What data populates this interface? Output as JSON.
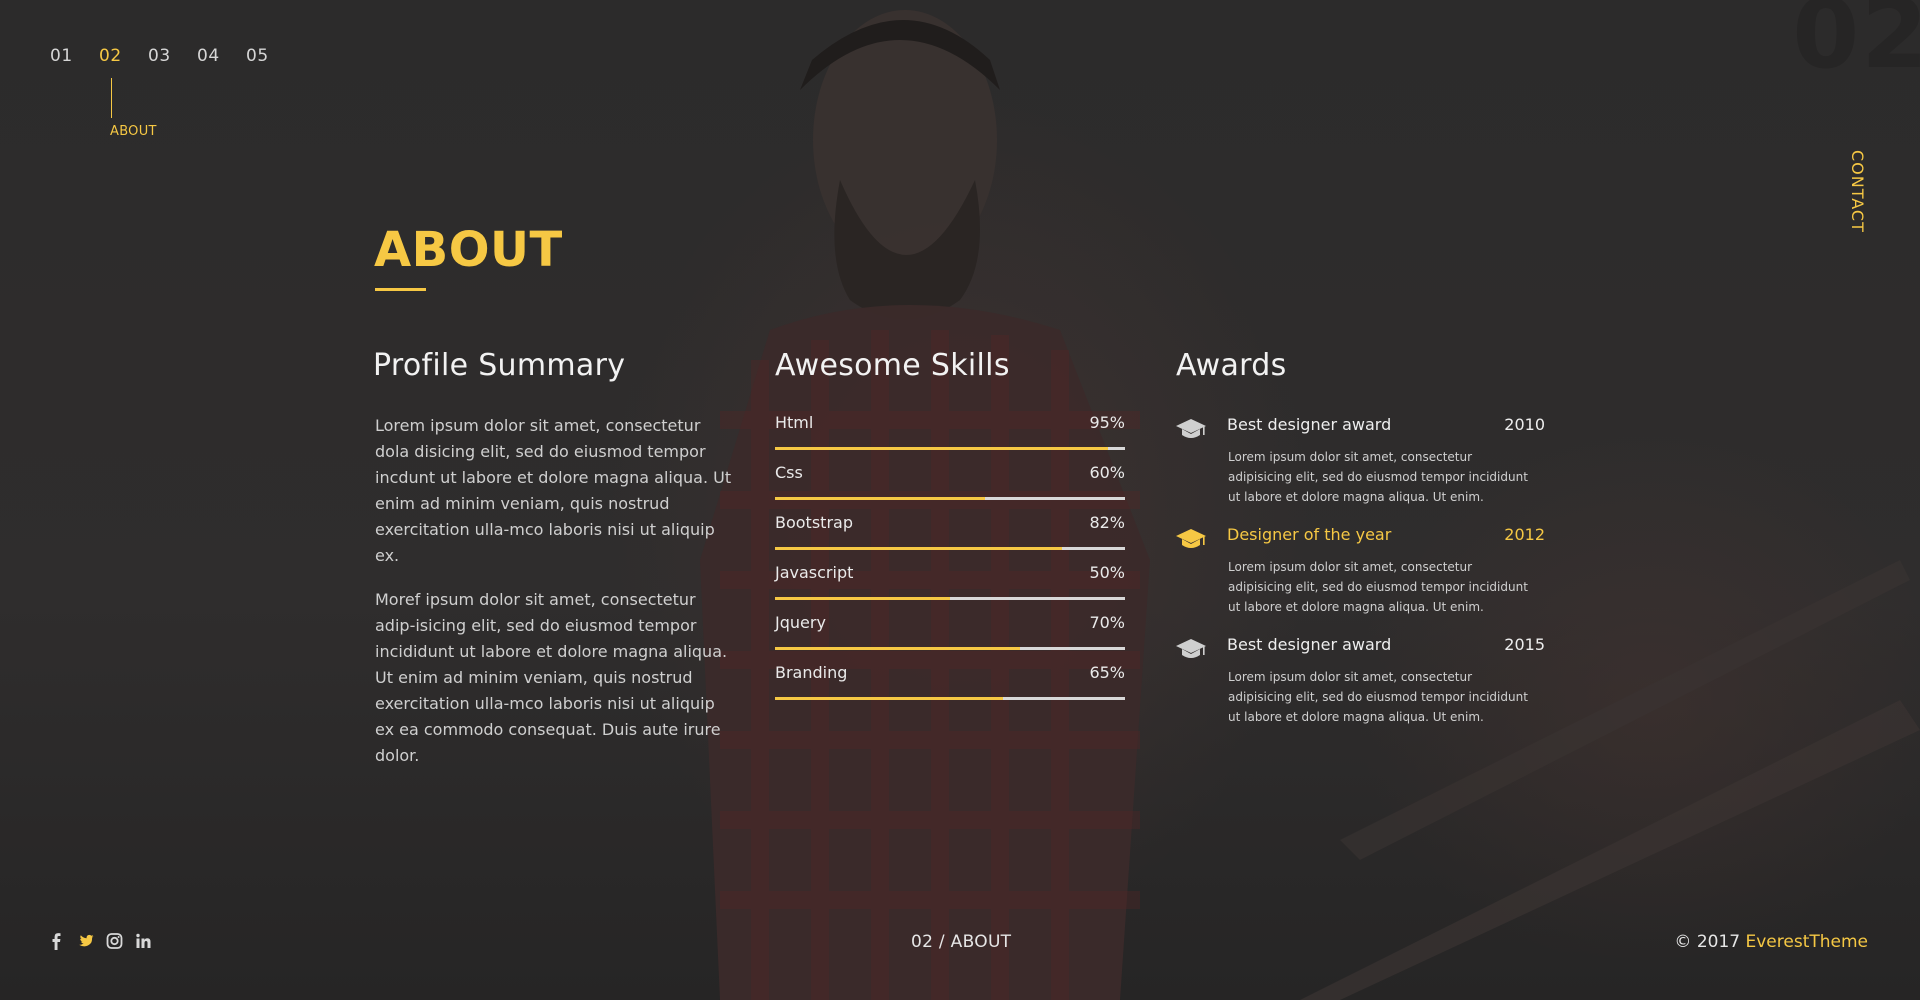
{
  "nav": {
    "items": [
      "01",
      "02",
      "03",
      "04",
      "05"
    ],
    "active_index": 1,
    "active_label": "ABOUT"
  },
  "section_number": "02",
  "contact_label": "CONTACT",
  "about": {
    "title": "ABOUT",
    "profile": {
      "heading": "Profile Summary",
      "paragraphs": [
        "Lorem ipsum dolor sit amet, consectetur dola disicing elit, sed do eiusmod tempor incdunt ut labore et dolore magna aliqua. Ut enim ad minim veniam, quis nostrud exercitation ulla-mco laboris nisi ut aliquip ex.",
        "Moref ipsum dolor sit amet, consectetur adip-isicing elit, sed do eiusmod tempor incididunt ut labore et dolore magna aliqua. Ut enim ad minim veniam, quis nostrud exercitation ulla-mco laboris nisi ut aliquip ex ea commodo consequat. Duis aute irure dolor."
      ]
    },
    "skills": {
      "heading": "Awesome Skills",
      "items": [
        {
          "name": "Html",
          "value": "95%",
          "level": 0.95
        },
        {
          "name": "Css",
          "value": "60%",
          "level": 0.6
        },
        {
          "name": "Bootstrap",
          "value": "82%",
          "level": 0.82
        },
        {
          "name": "Javascript",
          "value": "50%",
          "level": 0.5
        },
        {
          "name": "Jquery",
          "value": "70%",
          "level": 0.7
        },
        {
          "name": "Branding",
          "value": "65%",
          "level": 0.65
        }
      ]
    },
    "awards": {
      "heading": "Awards",
      "items": [
        {
          "name": "Best designer award",
          "year": "2010",
          "highlight": false,
          "icon": "graduation-cap-icon",
          "description": "Lorem ipsum dolor sit amet, consectetur adipisicing elit, sed do eiusmod tempor incididunt ut labore et dolore magna aliqua. Ut enim."
        },
        {
          "name": "Designer of the year",
          "year": "2012",
          "highlight": true,
          "icon": "graduation-cap-icon",
          "description": "Lorem ipsum dolor sit amet, consectetur adipisicing elit, sed do eiusmod tempor incididunt ut labore et dolore magna aliqua. Ut enim."
        },
        {
          "name": "Best designer award",
          "year": "2015",
          "highlight": false,
          "icon": "graduation-cap-icon",
          "description": "Lorem ipsum dolor sit amet, consectetur adipisicing elit, sed do eiusmod tempor incididunt ut labore et dolore magna aliqua. Ut enim."
        }
      ]
    }
  },
  "footer": {
    "social_icons": [
      "facebook-icon",
      "twitter-icon",
      "instagram-icon",
      "linkedin-icon"
    ],
    "page_indicator": "02 / ABOUT",
    "copyright": "© 2017",
    "brand": "EverestTheme"
  },
  "colors": {
    "accent": "#f6c844",
    "background": "#2d2c2c",
    "text": "#e6e6e6",
    "track": "#d8d8d8"
  }
}
